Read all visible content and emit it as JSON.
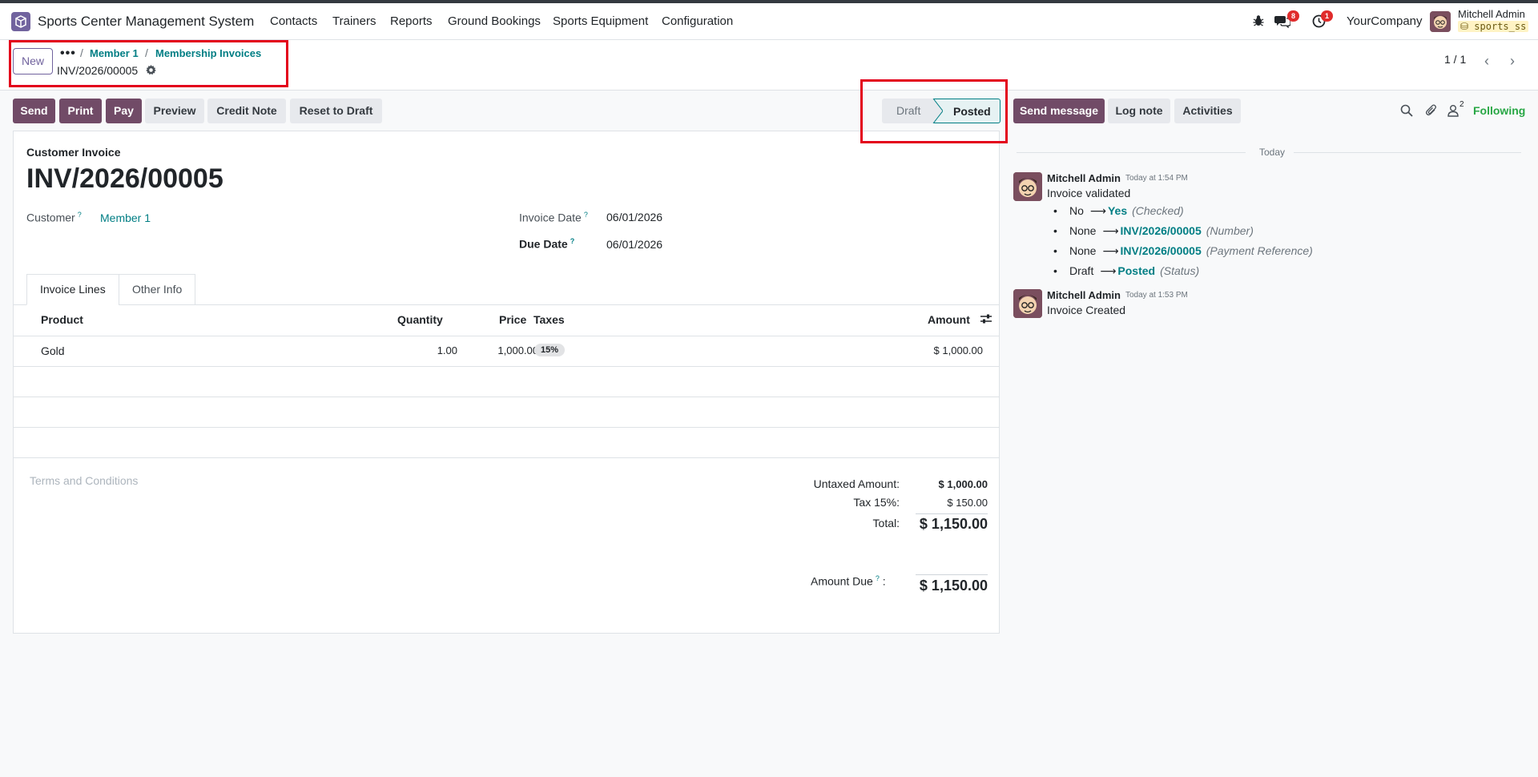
{
  "navbar": {
    "app_name": "Sports Center Management System",
    "menus": [
      "Contacts",
      "Trainers",
      "Reports",
      "Ground Bookings",
      "Sports Equipment",
      "Configuration"
    ],
    "messages_badge": "8",
    "activities_badge": "1",
    "company": "YourCompany",
    "user_name": "Mitchell Admin",
    "database": "sports_ss"
  },
  "control": {
    "new_label": "New",
    "breadcrumb": [
      "Member 1",
      "Membership Invoices"
    ],
    "record_name": "INV/2026/00005",
    "pager": "1 / 1"
  },
  "actions": {
    "send": "Send",
    "print": "Print",
    "pay": "Pay",
    "preview": "Preview",
    "credit_note": "Credit Note",
    "reset_to_draft": "Reset to Draft"
  },
  "status": {
    "draft": "Draft",
    "posted": "Posted",
    "current": "Posted"
  },
  "invoice": {
    "type_label": "Customer Invoice",
    "number": "INV/2026/00005",
    "customer_label": "Customer",
    "customer": "Member 1",
    "invoice_date_label": "Invoice Date",
    "invoice_date": "06/01/2026",
    "due_date_label": "Due Date",
    "due_date": "06/01/2026",
    "tabs": [
      "Invoice Lines",
      "Other Info"
    ],
    "columns": {
      "product": "Product",
      "quantity": "Quantity",
      "price": "Price",
      "taxes": "Taxes",
      "amount": "Amount"
    },
    "lines": [
      {
        "product": "Gold",
        "quantity": "1.00",
        "price": "1,000.00",
        "tax": "15%",
        "amount": "$ 1,000.00"
      }
    ],
    "terms_placeholder": "Terms and Conditions",
    "totals": {
      "untaxed_label": "Untaxed Amount:",
      "untaxed": "$ 1,000.00",
      "tax_label": "Tax 15%:",
      "tax": "$ 150.00",
      "total_label": "Total:",
      "total": "$ 1,150.00",
      "due_label": "Amount Due",
      "due": "$ 1,150.00"
    }
  },
  "chatter": {
    "send_message": "Send message",
    "log_note": "Log note",
    "activities": "Activities",
    "followers_count": "2",
    "following": "Following",
    "today": "Today",
    "messages": [
      {
        "author": "Mitchell Admin",
        "time": "Today at 1:54 PM",
        "body": "Invoice validated",
        "changes": [
          {
            "old": "No",
            "new": "Yes",
            "field": "(Checked)"
          },
          {
            "old": "None",
            "new": "INV/2026/00005",
            "field": "(Number)"
          },
          {
            "old": "None",
            "new": "INV/2026/00005",
            "field": "(Payment Reference)"
          },
          {
            "old": "Draft",
            "new": "Posted",
            "field": "(Status)"
          }
        ]
      },
      {
        "author": "Mitchell Admin",
        "time": "Today at 1:53 PM",
        "body": "Invoice Created",
        "changes": []
      }
    ]
  },
  "colors": {
    "brand": "#714b67",
    "link": "#017e84",
    "highlight_box": "#e3001b",
    "following": "#28a745"
  }
}
